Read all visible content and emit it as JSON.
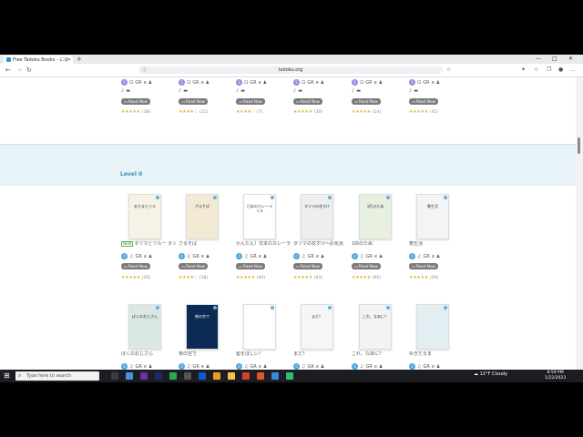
{
  "browser": {
    "tab_title": "Free Tadoku Books - にほんごたどく",
    "url": "tadoku.org",
    "new_tab": "+",
    "controls": [
      "—",
      "□",
      "✕"
    ]
  },
  "section": {
    "title": "Level 0"
  },
  "top_row": {
    "counts": [
      "(38)",
      "(21)",
      "(7)",
      "(30)",
      "(24)",
      "(41)"
    ],
    "stars": [
      "★★★★★",
      "★★★★☆",
      "★★★★☆",
      "★★★★★",
      "★★★★★",
      "★★★★★"
    ]
  },
  "read_now": "Read Now",
  "books_row1": [
    {
      "title": "タツマとツルー タツマ家族より",
      "new": "NEW",
      "count": "(35)",
      "stars": "★★★★★"
    },
    {
      "title": "ざるそば",
      "count": "(18)",
      "stars": "★★★★☆"
    },
    {
      "title": "かんたん！日本のカレーライス",
      "count": "(44)",
      "stars": "★★★★★"
    },
    {
      "title": "タツマの花すけ〜お花見",
      "count": "(63)",
      "stars": "★★★★★"
    },
    {
      "title": "1匹のたぬ",
      "count": "(60)",
      "stars": "★★★★★"
    },
    {
      "title": "寮生活",
      "count": "(29)",
      "stars": "★★★★★"
    }
  ],
  "books_row2": [
    {
      "title": "ぼくのおじさん",
      "count": "",
      "stars": ""
    },
    {
      "title": "夜の空で",
      "count": "(77)",
      "stars": "★★★★☆"
    },
    {
      "title": "髪をほしい！",
      "count": "",
      "stars": ""
    },
    {
      "title": "まだ？",
      "count": "(62)",
      "stars": "★★★★★"
    },
    {
      "title": "これ、なあに？",
      "count": "",
      "stars": ""
    },
    {
      "title": "ゆきだるま",
      "count": "",
      "stars": ""
    }
  ],
  "cover_texts": [
    "ありまとツル",
    "ざるそば",
    "日本のカレーライス",
    "タツマの花すけ",
    "1匹のたぬ",
    "寮生活",
    "ぼくのおじさん",
    "夜の空で",
    "",
    "まだ？",
    "これ、なあに？",
    ""
  ],
  "taskbar": {
    "search_placeholder": "Type here to search",
    "weather": "12°F Cloudy",
    "time": "8:59 PM",
    "date": "1/22/2023"
  },
  "colors": {
    "accent": "#4aa3d8",
    "band": "#e8f3f7",
    "star": "#e0b43a"
  }
}
